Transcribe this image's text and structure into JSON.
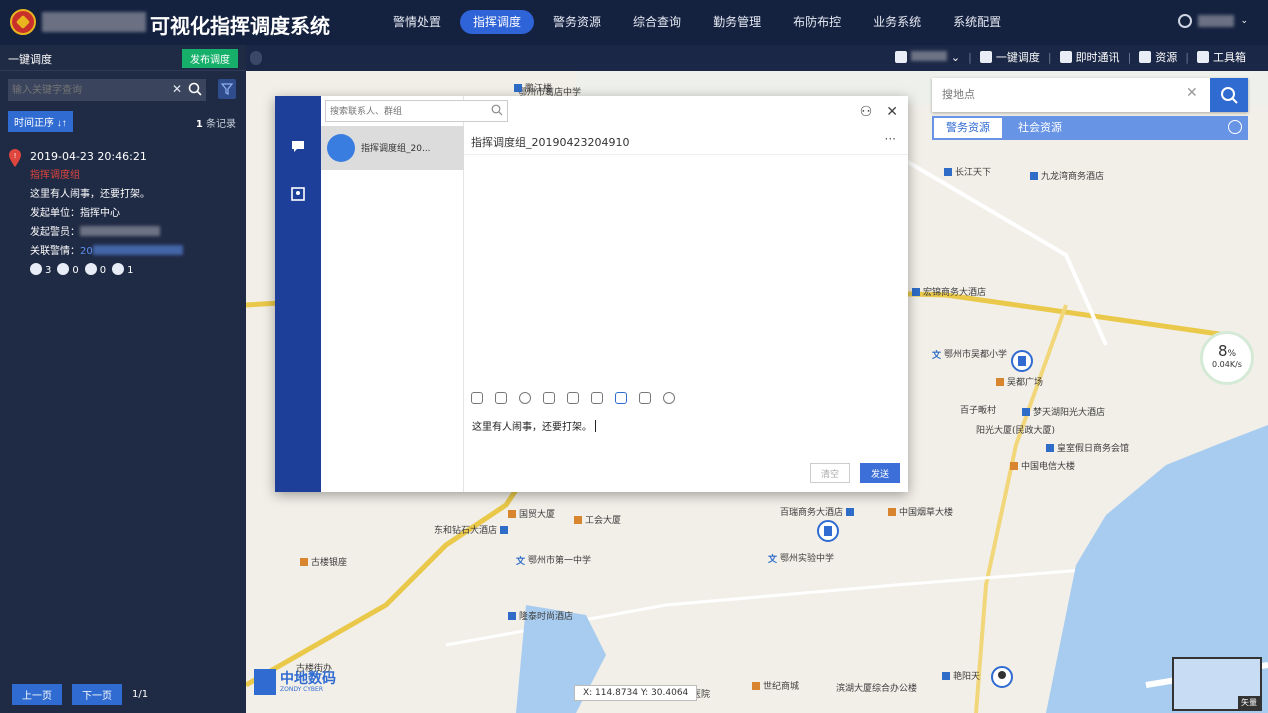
{
  "app": {
    "title": "可视化指挥调度系统"
  },
  "nav": {
    "items": [
      {
        "label": "警情处置"
      },
      {
        "label": "指挥调度",
        "active": true
      },
      {
        "label": "警务资源"
      },
      {
        "label": "综合查询"
      },
      {
        "label": "勤务管理"
      },
      {
        "label": "布防布控"
      },
      {
        "label": "业务系统"
      },
      {
        "label": "系统配置"
      }
    ]
  },
  "left": {
    "title": "一键调度",
    "publish_label": "发布调度",
    "search_placeholder": "输入关键字查询",
    "sort_label": "时间正序 ↓↑",
    "records_count": "1",
    "records_suffix": "条记录",
    "event": {
      "time": "2019-04-23 20:46:21",
      "category": "指挥调度组",
      "message": "这里有人闹事，还要打架。",
      "unit_label": "发起单位：",
      "unit_value": "指挥中心",
      "officer_label": "发起警员：",
      "case_label": "关联警情：",
      "case_value": "20",
      "stats": [
        {
          "icon": "police-car-icon",
          "value": "3"
        },
        {
          "icon": "car-icon",
          "value": "0"
        },
        {
          "icon": "radio-icon",
          "value": "0"
        },
        {
          "icon": "officer-icon",
          "value": "1"
        }
      ]
    },
    "pager": {
      "prev": "上一页",
      "next": "下一页",
      "page": "1/1"
    }
  },
  "map": {
    "toolbar": {
      "one_key": "一键调度",
      "instant": "即时通讯",
      "resource": "资源",
      "toolbox": "工具箱"
    },
    "search_placeholder": "搜地点",
    "tabs": {
      "police": "警务资源",
      "social": "社会资源"
    },
    "labels": [
      {
        "text": "鄂州市葛店中学",
        "kind": "poi"
      },
      {
        "text": "鹏江楼",
        "kind": "hotel"
      },
      {
        "text": "长江天下",
        "kind": "home"
      },
      {
        "text": "九龙湾商务酒店",
        "kind": "hotel"
      },
      {
        "text": "宏锦商务大酒店",
        "kind": "hotel"
      },
      {
        "text": "鄂州市吴都小学",
        "kind": "school"
      },
      {
        "text": "吴都广场",
        "kind": "poi"
      },
      {
        "text": "百子畈村",
        "kind": "place"
      },
      {
        "text": "梦天湖阳光大酒店",
        "kind": "hotel"
      },
      {
        "text": "阳光大厦(民政大厦)",
        "kind": "place"
      },
      {
        "text": "皇室假日商务会馆",
        "kind": "hotel"
      },
      {
        "text": "中国电信大楼",
        "kind": "poi"
      },
      {
        "text": "国贸大厦",
        "kind": "poi"
      },
      {
        "text": "工会大厦",
        "kind": "poi"
      },
      {
        "text": "百瑞商务大酒店",
        "kind": "hotel"
      },
      {
        "text": "中国烟草大楼",
        "kind": "poi"
      },
      {
        "text": "东和钻石大酒店",
        "kind": "hotel"
      },
      {
        "text": "鄂州市第一中学",
        "kind": "school"
      },
      {
        "text": "鄂州实验中学",
        "kind": "school"
      },
      {
        "text": "古楼银座",
        "kind": "poi"
      },
      {
        "text": "隆泰时尚酒店",
        "kind": "hotel"
      },
      {
        "text": "世纪商城",
        "kind": "poi"
      },
      {
        "text": "滨湖大厦综合办公楼",
        "kind": "place"
      },
      {
        "text": "艳阳天",
        "kind": "hotel"
      },
      {
        "text": "古楼街办",
        "kind": "place"
      },
      {
        "text": "中医医院",
        "kind": "place"
      }
    ],
    "gauge": {
      "percent": "8",
      "unit": "%",
      "speed": "0.04K/s"
    },
    "coords": "X: 114.8734  Y: 30.4064",
    "brand": {
      "name": "中地数码",
      "sub": "ZONDY CYBER"
    },
    "minimap_label": "矢量"
  },
  "chat": {
    "search_placeholder": "搜索联系人、群组",
    "contact_name": "指挥调度组_20...",
    "conversation_title": "指挥调度组_20190423204910",
    "input_text": "这里有人闹事，还要打架。",
    "clear_label": "清空",
    "send_label": "发送"
  },
  "colors": {
    "topbar": "#14213f",
    "accent": "#2f6bd1",
    "panel": "#1f2a44",
    "publish": "#16b06a"
  }
}
